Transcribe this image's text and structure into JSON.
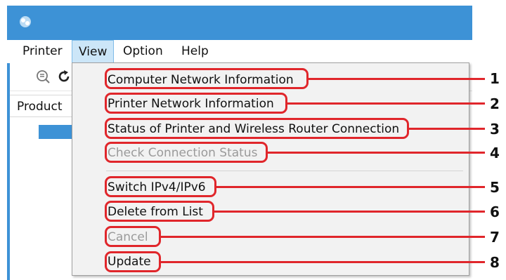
{
  "menubar": {
    "printer": "Printer",
    "view": "View",
    "option": "Option",
    "help": "Help"
  },
  "list": {
    "header": "Product"
  },
  "view_menu": {
    "items": [
      {
        "label": "Computer Network Information",
        "enabled": true
      },
      {
        "label": "Printer Network Information",
        "enabled": true
      },
      {
        "label": "Status of Printer and Wireless Router Connection",
        "enabled": true
      },
      {
        "label": "Check Connection Status",
        "enabled": false
      },
      {
        "label": "Switch IPv4/IPv6",
        "enabled": true
      },
      {
        "label": "Delete from List",
        "enabled": true
      },
      {
        "label": "Cancel",
        "enabled": false
      },
      {
        "label": "Update",
        "enabled": true
      }
    ]
  },
  "callouts": [
    "1",
    "2",
    "3",
    "4",
    "5",
    "6",
    "7",
    "8"
  ],
  "icons": {
    "app": "app-icon",
    "search": "search-icon",
    "refresh": "refresh-icon"
  },
  "colors": {
    "titlebar": "#3d92d6",
    "callout": "#e0262b",
    "menu_bg": "#f2f2f2",
    "disabled_text": "#9a9a9a"
  }
}
